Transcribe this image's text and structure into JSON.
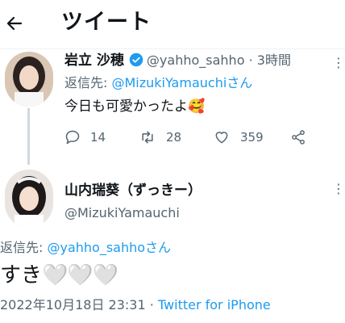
{
  "header": {
    "back_icon": "arrow-left-icon",
    "title": "ツイート"
  },
  "parent_tweet": {
    "display_name": "岩立 沙穂",
    "verified_icon": "verified-badge-icon",
    "handle": "@yahho_sahho",
    "separator": "·",
    "time_ago": "3時間",
    "reply_prefix": "返信先: ",
    "reply_to": "@MizukiYamauchi",
    "reply_suffix": "さん",
    "text": "今日も可愛かったよ🥰",
    "actions": {
      "replies": "14",
      "retweets": "28",
      "likes": "359"
    },
    "icons": [
      "comment-icon",
      "retweet-icon",
      "heart-icon",
      "share-icon"
    ],
    "more_icon": "more-icon"
  },
  "main_tweet": {
    "display_name": "山内瑞葵（ずっきー）",
    "handle": "@MizukiYamauchi",
    "more_icon": "more-icon",
    "reply_prefix": "返信先: ",
    "reply_to": "@yahho_sahho",
    "reply_suffix": "さん",
    "text": "すき",
    "hearts": "🤍🤍🤍",
    "date": "2022年10月18日 23:31",
    "separator": "·",
    "source": "Twitter for iPhone"
  },
  "colors": {
    "link": "#1d9bf0",
    "muted": "#536471",
    "text": "#0f1419"
  }
}
